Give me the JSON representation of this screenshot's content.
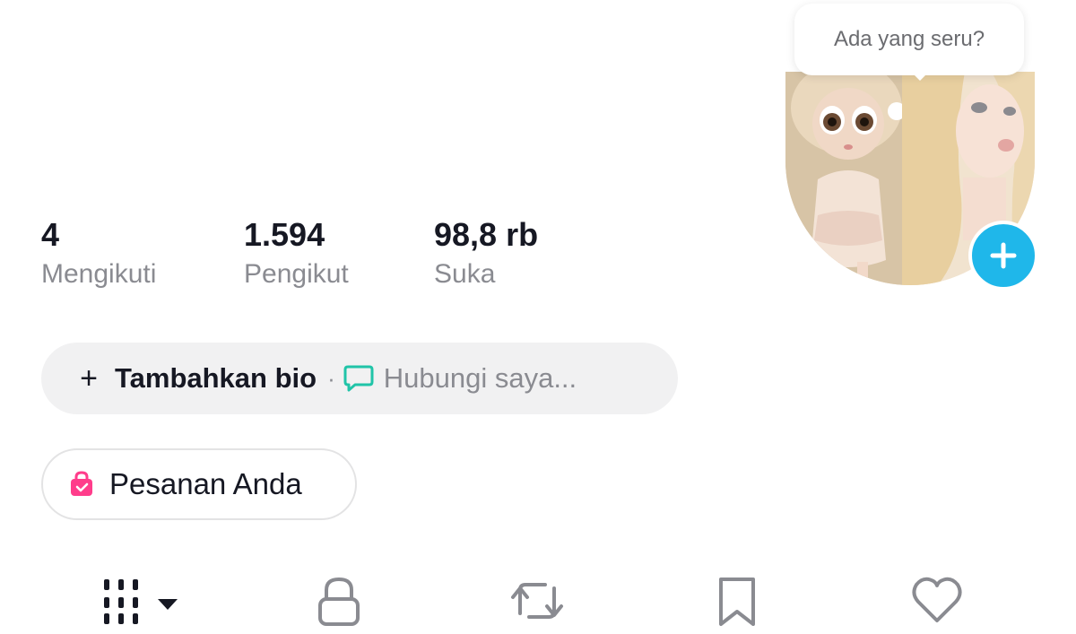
{
  "stats": [
    {
      "value": "4",
      "label": "Mengikuti"
    },
    {
      "value": "1.594",
      "label": "Pengikut"
    },
    {
      "value": "98,8 rb",
      "label": "Suka"
    }
  ],
  "bio": {
    "add_label": "Tambahkan bio",
    "separator": "·",
    "contact_label": "Hubungi saya..."
  },
  "orders": {
    "label": "Pesanan Anda"
  },
  "tooltip": {
    "text": "Ada yang seru?"
  },
  "tabs": [
    {
      "name": "posts-grid",
      "icon": "grid-icon"
    },
    {
      "name": "private",
      "icon": "lock-icon"
    },
    {
      "name": "reposts",
      "icon": "repost-icon"
    },
    {
      "name": "favorites",
      "icon": "bookmark-icon"
    },
    {
      "name": "liked",
      "icon": "heart-icon"
    }
  ],
  "colors": {
    "text_primary": "#161823",
    "text_secondary": "#8a8b91",
    "pill_bg": "#f1f1f2",
    "accent_blue": "#1fb7ea",
    "contact_icon": "#20c4a8",
    "orders_icon": "#ff3d8b"
  }
}
